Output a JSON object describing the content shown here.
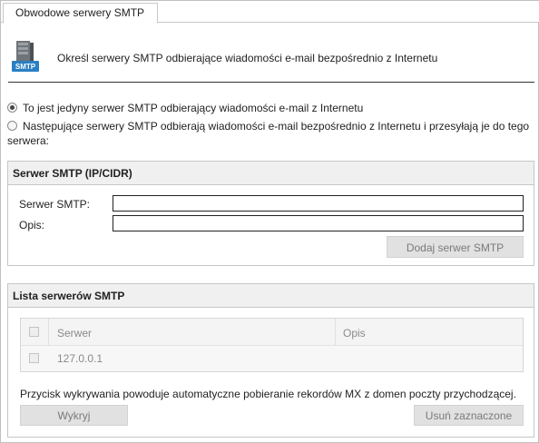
{
  "tab": {
    "label": "Obwodowe serwery SMTP"
  },
  "header": {
    "icon_badge": "SMTP",
    "description": "Określ serwery SMTP odbierające wiadomości e-mail bezpośrednio z Internetu"
  },
  "options": {
    "only_server": "To jest jedyny serwer SMTP odbierający wiadomości e-mail z Internetu",
    "following_servers_line1": "Następujące serwery SMTP odbierają wiadomości e-mail bezpośrednio z Internetu i przesyłają je do tego",
    "following_servers_line2": "serwera:",
    "selected": "only_server"
  },
  "smtp_section": {
    "title": "Serwer SMTP (IP/CIDR)",
    "server_label": "Serwer SMTP:",
    "server_value": "",
    "desc_label": "Opis:",
    "desc_value": "",
    "add_button": "Dodaj serwer SMTP"
  },
  "list_section": {
    "title": "Lista serwerów SMTP",
    "columns": [
      "Serwer",
      "Opis"
    ],
    "rows": [
      {
        "server": "127.0.0.1",
        "description": "",
        "checked": false
      }
    ],
    "note": "Przycisk wykrywania powoduje automatyczne pobieranie rekordów MX z domen poczty przychodzącej.",
    "detect_button": "Wykryj",
    "remove_button": "Usuń zaznaczone"
  },
  "colors": {
    "border": "#c6c6c6",
    "section_header_bg": "#f0f0f0",
    "disabled_button_bg": "#e1e1e1",
    "disabled_text": "#7a7a7a",
    "icon_blue": "#2a7fc4"
  }
}
